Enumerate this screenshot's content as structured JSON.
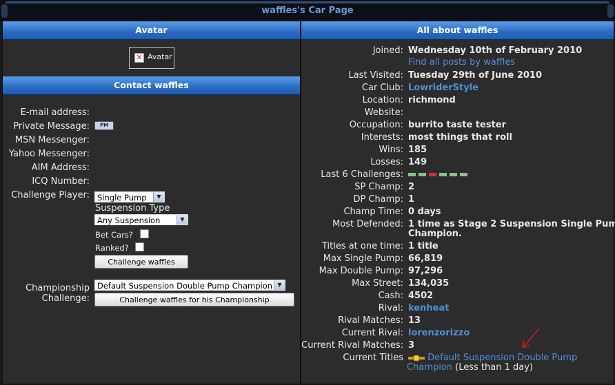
{
  "page": {
    "title": "waffles's Car Page"
  },
  "avatar_panel": {
    "header": "Avatar",
    "avatar_label": "Avatar"
  },
  "contact": {
    "header": "Contact waffles",
    "email_label": "E-mail address:",
    "pm_label": "Private Message:",
    "pm_icon_text": "PM",
    "msn_label": "MSN Messenger:",
    "yahoo_label": "Yahoo Messenger:",
    "aim_label": "AIM Address:",
    "icq_label": "ICQ Number:",
    "challenge_label": "Challenge Player:",
    "pump_select": "Single Pump",
    "suspension_type_label": "Suspension Type",
    "suspension_select": "Any Suspension",
    "bet_cars_label": "Bet Cars?",
    "ranked_label": "Ranked?",
    "challenge_button": "Challenge waffles",
    "championship_label_1": "Championship",
    "championship_label_2": "Challenge:",
    "championship_select": "Default Suspension Double Pump Champion",
    "championship_button": "Challenge waffles for his Championship"
  },
  "about": {
    "header": "All about waffles",
    "joined_label": "Joined:",
    "joined": "Wednesday 10th of February 2010",
    "find_posts": "Find all posts by waffles",
    "last_visited_label": "Last Visited:",
    "last_visited": "Tuesday 29th of June 2010",
    "car_club_label": "Car Club:",
    "car_club": "LowriderStyle",
    "location_label": "Location:",
    "location": "richmond",
    "website_label": "Website:",
    "occupation_label": "Occupation:",
    "occupation": "burrito taste tester",
    "interests_label": "Interests:",
    "interests": "most things that roll",
    "wins_label": "Wins:",
    "wins": "185",
    "losses_label": "Losses:",
    "losses": "149",
    "last6_label": "Last 6 Challenges:",
    "last6_colors": [
      "#8fbf8f",
      "#8fbf8f",
      "#d03030",
      "#8fbf8f",
      "#8fbf8f",
      "#8fbf8f"
    ],
    "sp_champ_label": "SP Champ:",
    "sp_champ": "2",
    "dp_champ_label": "DP Champ:",
    "dp_champ": "1",
    "champ_time_label": "Champ Time:",
    "champ_time": "0 days",
    "most_defended_label": "Most Defended:",
    "most_defended_1": "1 time as Stage 2 Suspension Single Pump",
    "most_defended_2": "Champion.",
    "titles_label": "Titles at one time:",
    "titles": "1 title",
    "max_sp_label": "Max Single Pump:",
    "max_sp": "66,819",
    "max_dp_label": "Max Double Pump:",
    "max_dp": "97,296",
    "max_street_label": "Max Street:",
    "max_street": "134,035",
    "cash_label": "Cash:",
    "cash": "4502",
    "rival_label": "Rival:",
    "rival": "kenheat",
    "rival_matches_label": "Rival Matches:",
    "rival_matches": "13",
    "current_rival_label": "Current Rival:",
    "current_rival": "lorenzorizzo",
    "current_rival_matches_label": "Current Rival Matches:",
    "current_rival_matches": "3",
    "current_titles_label": "Current Titles",
    "current_title_1": "Default Suspension Double Pump",
    "current_title_2": "Champion",
    "current_title_note": "(Less than 1 day)"
  },
  "colors": {
    "accent": "#2c6ec5",
    "link": "#4f8fd6",
    "panel": "#2c2c2c"
  }
}
